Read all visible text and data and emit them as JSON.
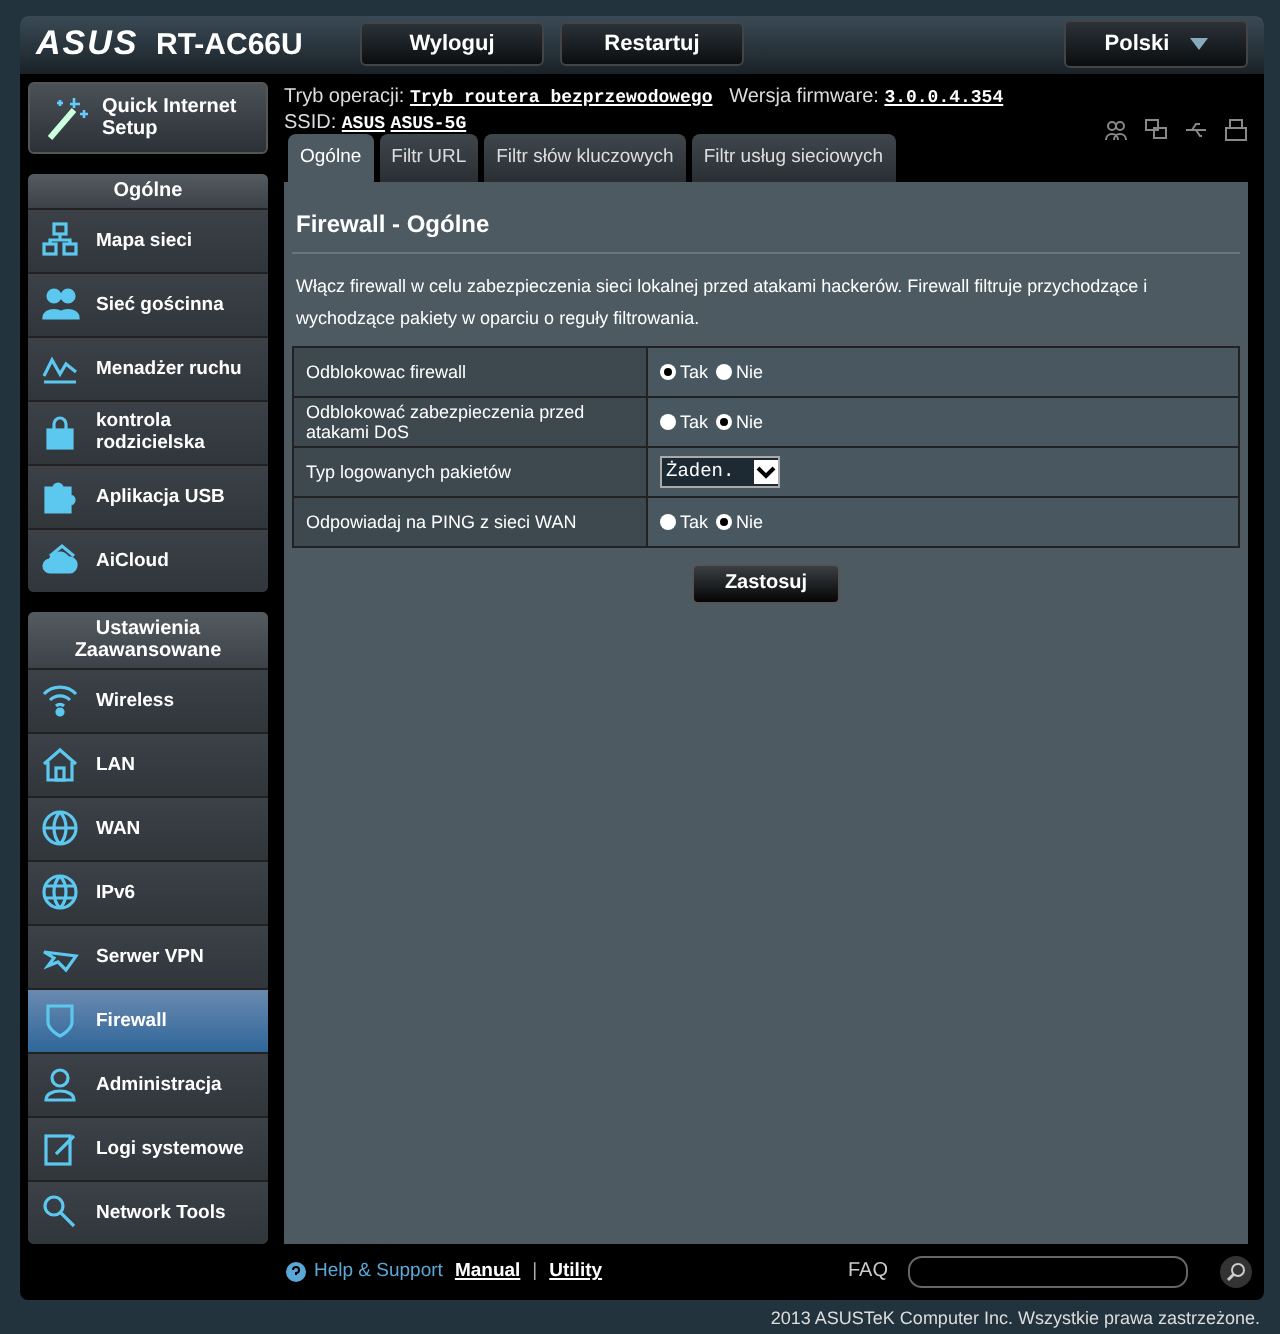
{
  "header": {
    "logo": "ASUS",
    "model": "RT-AC66U",
    "buttons": [
      "Wyloguj",
      "Restartuj"
    ],
    "language": "Polski"
  },
  "info": {
    "mode_label": "Tryb operacji:",
    "mode": "Tryb routera bezprzewodowego",
    "firmware_label": "Wersja firmware:",
    "firmware": "3.0.0.4.354",
    "ssid_label": "SSID:",
    "ssids": [
      "ASUS",
      "ASUS-5G"
    ]
  },
  "quick_setup": "Quick Internet Setup",
  "sidebar": [
    {
      "heading": "Ogólne",
      "items": [
        {
          "label": "Mapa sieci",
          "selected": false
        },
        {
          "label": "Sieć gościnna",
          "selected": false
        },
        {
          "label": "Menadżer ruchu",
          "selected": false
        },
        {
          "label": "kontrola rodzicielska",
          "selected": false
        },
        {
          "label": "Aplikacja USB",
          "selected": false
        },
        {
          "label": "AiCloud",
          "selected": false
        }
      ]
    },
    {
      "heading": "Ustawienia Zaawansowane",
      "items": [
        {
          "label": "Wireless",
          "selected": false
        },
        {
          "label": "LAN",
          "selected": false
        },
        {
          "label": "WAN",
          "selected": false
        },
        {
          "label": "IPv6",
          "selected": false
        },
        {
          "label": "Serwer VPN",
          "selected": false
        },
        {
          "label": "Firewall",
          "selected": true
        },
        {
          "label": "Administracja",
          "selected": false
        },
        {
          "label": "Logi systemowe",
          "selected": false
        },
        {
          "label": "Network Tools",
          "selected": false
        }
      ]
    }
  ],
  "tabs": [
    {
      "label": "Ogólne",
      "selected": true
    },
    {
      "label": "Filtr URL",
      "selected": false
    },
    {
      "label": "Filtr słów kluczowych",
      "selected": false
    },
    {
      "label": "Filtr usług sieciowych",
      "selected": false
    }
  ],
  "panel": {
    "title": "Firewall - Ogólne",
    "description": "Włącz firewall w celu zabezpieczenia sieci lokalnej przed atakami hackerów. Firewall filtruje przychodzące i wychodzące pakiety w oparciu o reguły filtrowania.",
    "settings": [
      {
        "kind": "radio",
        "label": "Odblokowac firewall",
        "options": [
          {
            "label": "Tak",
            "selected": true
          },
          {
            "label": "Nie",
            "selected": false
          }
        ]
      },
      {
        "kind": "radio",
        "label": "Odblokować zabezpieczenia przed atakami DoS",
        "options": [
          {
            "label": "Tak",
            "selected": false
          },
          {
            "label": "Nie",
            "selected": true
          }
        ]
      },
      {
        "kind": "select",
        "label": "Typ logowanych pakietów",
        "value": "Żaden."
      },
      {
        "kind": "radio",
        "label": "Odpowiadaj na PING z sieci WAN",
        "options": [
          {
            "label": "Tak",
            "selected": false
          },
          {
            "label": "Nie",
            "selected": true
          }
        ]
      }
    ],
    "apply": "Zastosuj"
  },
  "footer": {
    "help": "Help & Support",
    "links": [
      "Manual",
      "Utility"
    ],
    "separator": "|",
    "faq": "FAQ"
  },
  "copyright": "2013 ASUSTeK Computer Inc. Wszystkie prawa zastrzeżone."
}
